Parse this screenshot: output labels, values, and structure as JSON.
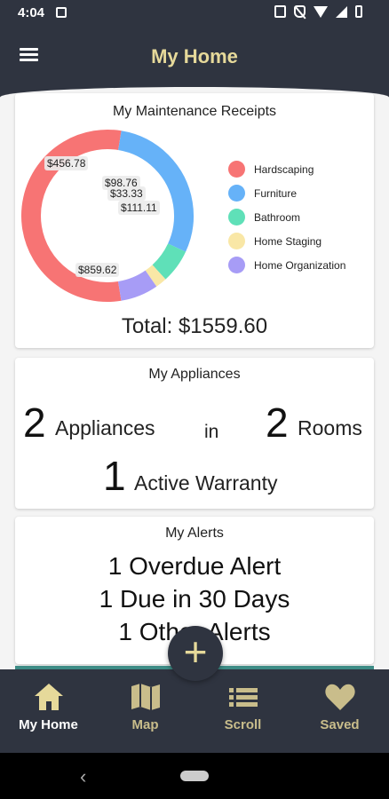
{
  "status_bar": {
    "time": "4:04"
  },
  "app_bar": {
    "title": "My Home"
  },
  "receipts": {
    "title": "My Maintenance Receipts",
    "total": "Total: $1559.60",
    "chart_data": {
      "type": "pie",
      "categories": [
        "Hardscaping",
        "Furniture",
        "Bathroom",
        "Home Staging",
        "Home Organization"
      ],
      "values": [
        859.62,
        456.78,
        98.76,
        33.33,
        111.11
      ],
      "labels": [
        "$859.62",
        "$456.78",
        "$98.76",
        "$33.33",
        "$111.11"
      ],
      "colors": [
        "#f77474",
        "#66b2f8",
        "#5fe0b8",
        "#f9e7a6",
        "#a79cf6"
      ],
      "legend": "right"
    }
  },
  "appliances": {
    "title": "My Appliances",
    "appliance_count": "2",
    "appliance_word": "Appliances",
    "connector": "in",
    "room_count": "2",
    "room_word": "Rooms",
    "warranty_count": "1",
    "warranty_word": "Active Warranty"
  },
  "alerts": {
    "title": "My Alerts",
    "lines": [
      "1 Overdue Alert",
      "1 Due in 30 Days",
      "1 Other Alerts"
    ]
  },
  "fab": {
    "label": "+"
  },
  "bottom_nav": {
    "items": [
      {
        "label": "My Home",
        "icon": "home-icon"
      },
      {
        "label": "Map",
        "icon": "map-icon"
      },
      {
        "label": "Scroll",
        "icon": "list-icon"
      },
      {
        "label": "Saved",
        "icon": "heart-icon"
      }
    ]
  },
  "system_nav": {
    "back": "‹"
  }
}
